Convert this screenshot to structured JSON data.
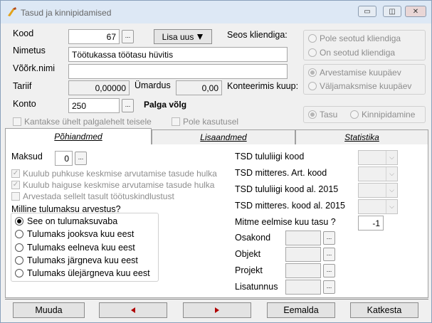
{
  "window": {
    "title": "Tasud ja kinnipidamised",
    "buttons": {
      "minimize": "▭",
      "maximize": "◫",
      "close": "✕"
    }
  },
  "header": {
    "kood_label": "Kood",
    "kood_value": "67",
    "lisa_uus_label": "Lisa uus",
    "lisa_uus_arrow": "🞃",
    "seos_label": "Seos kliendiga:",
    "nimetus_label": "Nimetus",
    "nimetus_value": "Töötukassa töötasu hüvitis",
    "voork_label": "Võõrk.nimi",
    "voork_value": "",
    "tariif_label": "Tariif",
    "tariif_value": "0,00000",
    "umardus_label": "Ümardus",
    "umardus_value": "0,00",
    "konteerimis_label": "Konteerimis kuup:",
    "konto_label": "Konto",
    "konto_value": "250",
    "konto_name": "Palga võlg",
    "dots": "...",
    "kantakse_label": "Kantakse ühelt palgalehelt teisele",
    "pole_kasutusel_label": "Pole kasutusel"
  },
  "seos": {
    "options": [
      "Pole seotud kliendiga",
      "On seotud kliendiga"
    ],
    "selected": 0
  },
  "kuup": {
    "options": [
      "Arvestamise kuupäev",
      "Väljamaksmise kuupäev"
    ],
    "selected": 0
  },
  "liik": {
    "options": [
      "Tasu",
      "Kinnipidamine"
    ],
    "selected": 0
  },
  "tabs": [
    {
      "label": "Põhiandmed",
      "active": true
    },
    {
      "label": "Lisaandmed",
      "active": false
    },
    {
      "label": "Statistika",
      "active": false
    }
  ],
  "pohiandmed": {
    "maksud_label": "Maksud",
    "maksud_value": "0",
    "checks": [
      {
        "label": "Kuulub puhkuse keskmise arvutamise tasude hulka",
        "checked": true
      },
      {
        "label": "Kuulub haiguse keskmise arvutamise tasude hulka",
        "checked": true
      },
      {
        "label": "Arvestada sellelt tasult töötuskindlustust",
        "checked": false
      }
    ],
    "tulumaks_label": "Milline tulumaksu arvestus?",
    "tulumaks_options": [
      "See on tulumaksuvaba",
      "Tulumaks jooksva kuu eest",
      "Tulumaks eelneva kuu eest",
      "Tulumaks järgneva kuu eest",
      "Tulumaks ülejärgneva kuu eest"
    ],
    "tulumaks_selected": 0,
    "tsd": [
      {
        "label": "TSD tululiigi kood",
        "value": ""
      },
      {
        "label": "TSD mitteres. Art. kood",
        "value": ""
      },
      {
        "label": "TSD tululiigi kood al. 2015",
        "value": ""
      },
      {
        "label": "TSD mitteres. kood al. 2015",
        "value": ""
      }
    ],
    "mitme_label": "Mitme eelmise kuu tasu ?",
    "mitme_value": "-1",
    "dims": [
      {
        "label": "Osakond",
        "value": ""
      },
      {
        "label": "Objekt",
        "value": ""
      },
      {
        "label": "Projekt",
        "value": ""
      },
      {
        "label": "Lisatunnus",
        "value": ""
      }
    ]
  },
  "footer": {
    "muuda_label": "Muuda",
    "eemalda_label": "Eemalda",
    "katkesta_label": "Katkesta"
  }
}
